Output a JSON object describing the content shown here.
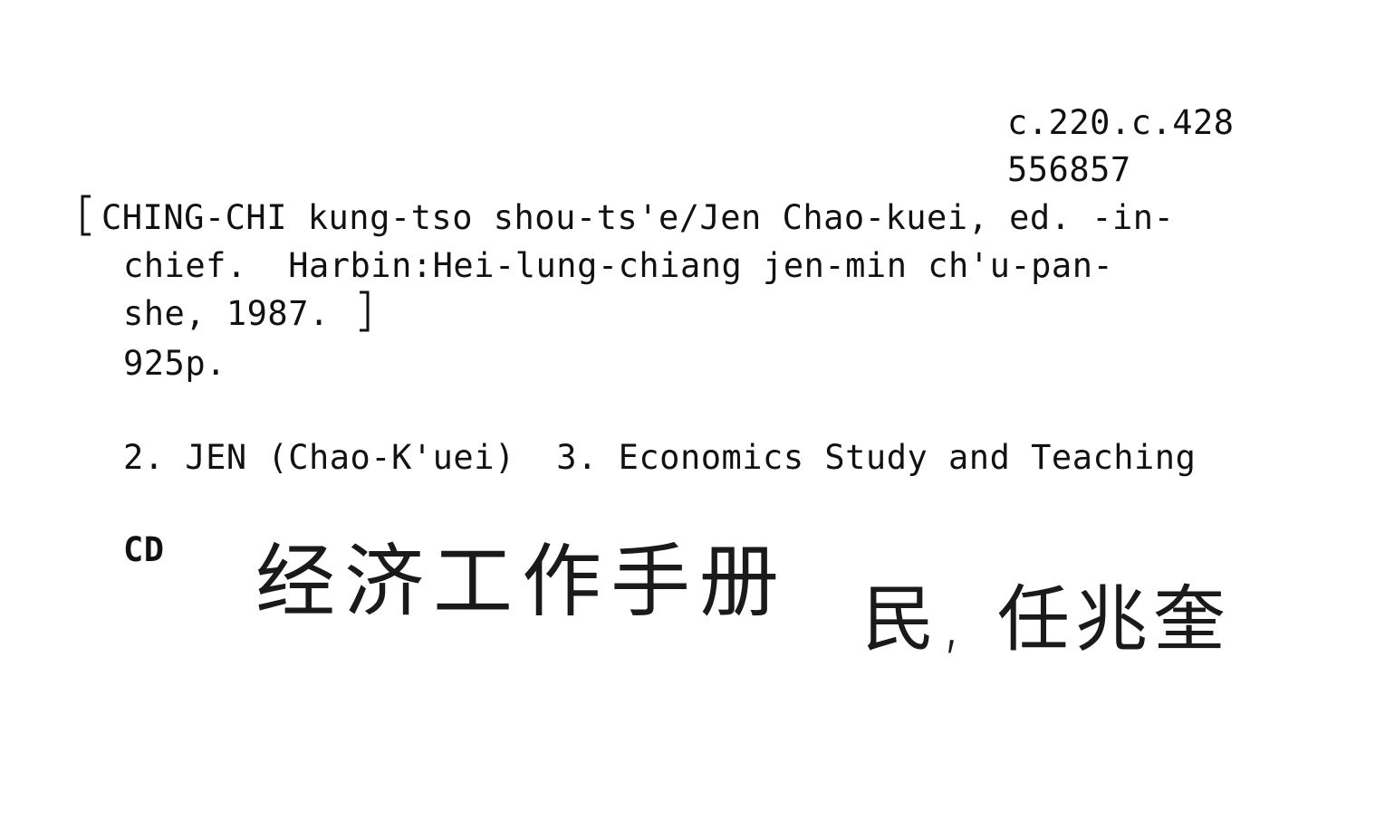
{
  "card": {
    "shelfmark": "c.220.c.428",
    "accession": "556857",
    "bracket_open": "[",
    "bracket_close": "]",
    "title_line1": "CHING-CHI kung-tso shou-ts'e/Jen Chao-kuei, ed. -in-",
    "title_line2": "chief.  Harbin:Hei-lung-chiang jen-min ch'u-pan-",
    "title_line3": "she, 1987.",
    "pagination": "925p.",
    "tracings": "2. JEN (Chao-K'uei)  3. Economics Study and Teaching",
    "cd_label": "CD",
    "handwritten_title": "经济工作手册",
    "handwritten_author": "民, 任兆奎"
  }
}
